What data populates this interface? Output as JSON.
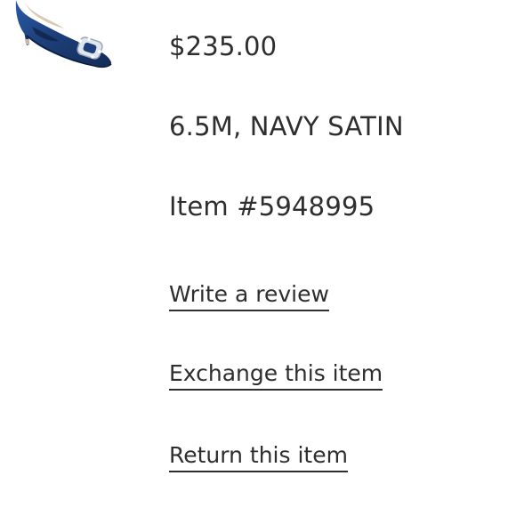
{
  "product": {
    "image_icon": "navy-satin-pump-shoe",
    "price": "$235.00",
    "variant": "6.5M, NAVY SATIN",
    "item_number": "Item #5948995"
  },
  "actions": {
    "write_review": "Write a review",
    "exchange": "Exchange this item",
    "return": "Return this item"
  },
  "colors": {
    "text": "#2e2e2e",
    "shoe_navy": "#1d3f7a",
    "background": "#ffffff"
  }
}
